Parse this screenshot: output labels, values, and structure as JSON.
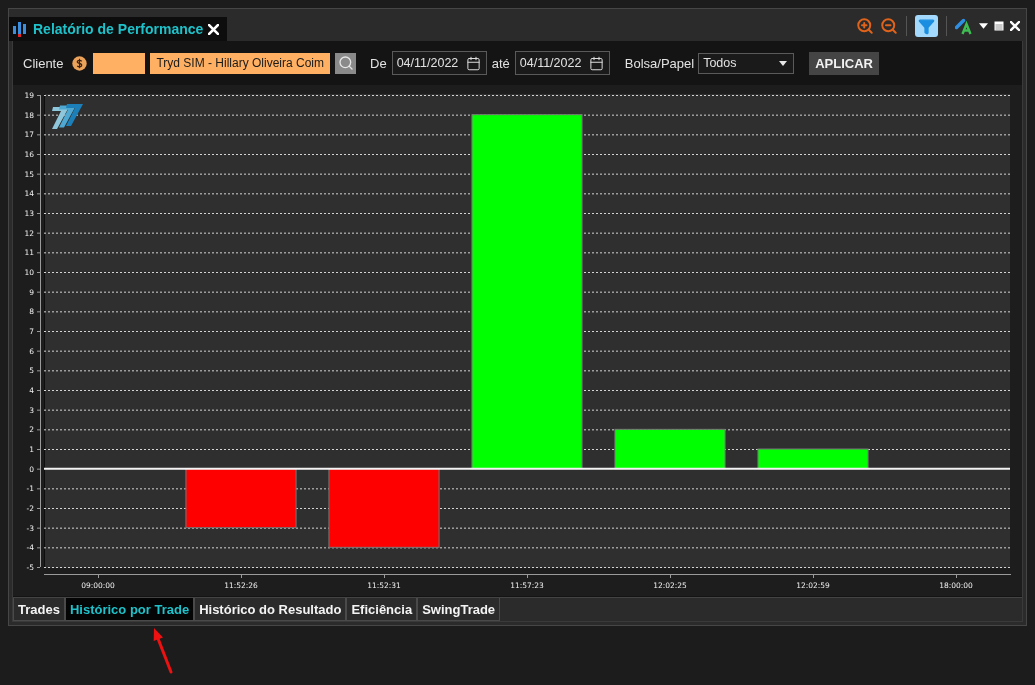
{
  "window": {
    "title": "Relatório de Performance",
    "filter_on": true
  },
  "toolbar": {
    "client_label": "Cliente",
    "client_name": "Tryd SIM - Hillary Oliveira Coim",
    "from_label": "De",
    "from_date": "04/11/2022",
    "to_label": "até",
    "to_date": "04/11/2022",
    "market_label": "Bolsa/Papel",
    "market_value": "Todos",
    "apply_button": "APLICAR"
  },
  "chart": {
    "chart_data": {
      "type": "bar",
      "categories": [
        "09:00:00",
        "11:52:26",
        "11:52:31",
        "11:57:23",
        "12:02:25",
        "12:02:59",
        "18:00:00"
      ],
      "values": [
        0,
        -3,
        -4,
        18,
        2,
        1,
        0
      ],
      "ylim": [
        -5,
        19
      ],
      "yticks": [
        -5,
        -4,
        -3,
        -2,
        -1,
        0,
        1,
        2,
        3,
        4,
        5,
        6,
        7,
        8,
        9,
        10,
        11,
        12,
        13,
        14,
        15,
        16,
        17,
        18,
        19
      ],
      "grid": true
    }
  },
  "tabs": [
    {
      "label": "Trades",
      "selected": false
    },
    {
      "label": "Histórico por Trade",
      "selected": true
    },
    {
      "label": "Histórico do Resultado",
      "selected": false
    },
    {
      "label": "Eficiência",
      "selected": false
    },
    {
      "label": "SwingTrade",
      "selected": false
    }
  ]
}
